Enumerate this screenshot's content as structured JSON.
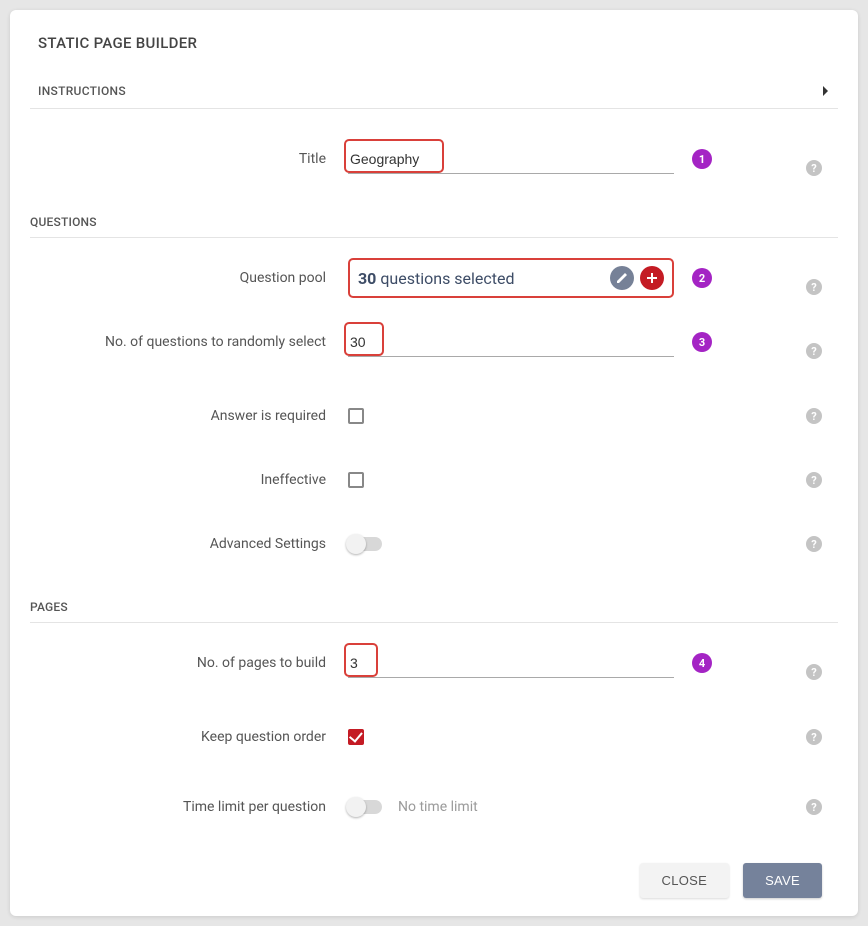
{
  "panel": {
    "title": "STATIC PAGE BUILDER"
  },
  "accordion": {
    "instructions_label": "INSTRUCTIONS"
  },
  "title_row": {
    "label": "Title",
    "value": "Geography",
    "marker": "1"
  },
  "sections": {
    "questions": "QUESTIONS",
    "pages": "PAGES"
  },
  "pool": {
    "label": "Question pool",
    "count": "30",
    "suffix": "questions selected",
    "marker": "2"
  },
  "randselect": {
    "label": "No. of questions to randomly select",
    "value": "30",
    "marker": "3"
  },
  "answer_required": {
    "label": "Answer is required"
  },
  "ineffective": {
    "label": "Ineffective"
  },
  "advanced": {
    "label": "Advanced Settings"
  },
  "pages_build": {
    "label": "No. of pages to build",
    "value": "3",
    "marker": "4"
  },
  "keep_order": {
    "label": "Keep question order"
  },
  "time_limit": {
    "label": "Time limit per question",
    "note": "No time limit"
  },
  "actions": {
    "close": "CLOSE",
    "save": "SAVE"
  }
}
